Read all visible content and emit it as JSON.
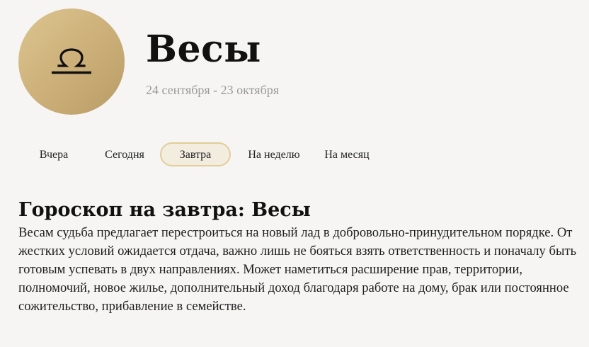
{
  "header": {
    "sign_name": "Весы",
    "sign_dates": "24 сентября - 23 октября",
    "sign_icon": "libra-icon",
    "badge_colors": [
      "#dcc58f",
      "#b89c66"
    ]
  },
  "tabs": [
    {
      "label": "Вчера",
      "active": false
    },
    {
      "label": "Сегодня",
      "active": false
    },
    {
      "label": "Завтра",
      "active": true
    },
    {
      "label": "На неделю",
      "active": false
    },
    {
      "label": "На месяц",
      "active": false
    }
  ],
  "content": {
    "title": "Гороскоп на завтра: Весы",
    "text": "Весам судьба предлагает перестроиться на новый лад в добровольно-принудительном порядке. От жестких условий ожидается отдача, важно лишь не бояться взять ответственность и поначалу быть готовым успевать в двух направлениях. Может наметиться расширение прав, территории, полномочий, новое жилье, дополнительный доход благодаря работе на дому, брак или постоянное сожительство, прибавление в семействе."
  },
  "colors": {
    "accent_border": "#e2cd98",
    "active_tab_bg": "#f3ede0",
    "muted_text": "#9a9a9a"
  }
}
